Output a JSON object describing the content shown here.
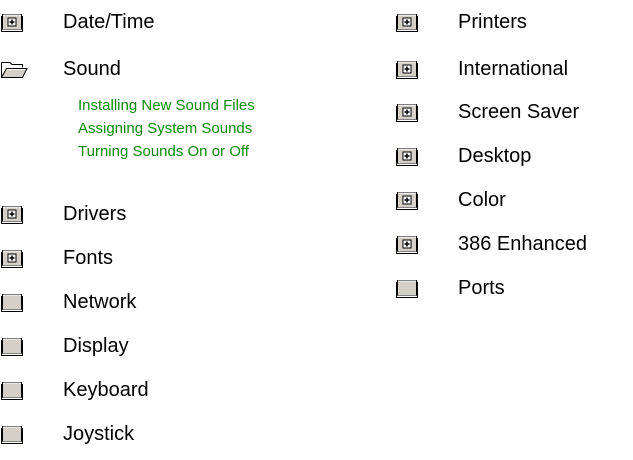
{
  "left_column": [
    {
      "label": "Date/Time",
      "icon": "book-closed-plus-icon"
    },
    {
      "label": "Sound",
      "icon": "book-open-icon"
    },
    {
      "label": "Drivers",
      "icon": "book-closed-plus-icon"
    },
    {
      "label": "Fonts",
      "icon": "book-closed-plus-icon"
    },
    {
      "label": "Network",
      "icon": "book-closed-icon"
    },
    {
      "label": "Display",
      "icon": "book-closed-icon"
    },
    {
      "label": "Keyboard",
      "icon": "book-closed-icon"
    },
    {
      "label": "Joystick",
      "icon": "book-closed-icon"
    }
  ],
  "sound_topics": [
    "Installing New Sound Files",
    "Assigning System Sounds",
    "Turning Sounds On or Off"
  ],
  "right_column": [
    {
      "label": "Printers",
      "icon": "book-closed-plus-icon"
    },
    {
      "label": "International",
      "icon": "book-closed-plus-icon"
    },
    {
      "label": "Screen Saver",
      "icon": "book-closed-plus-icon"
    },
    {
      "label": "Desktop",
      "icon": "book-closed-plus-icon"
    },
    {
      "label": "Color",
      "icon": "book-closed-plus-icon"
    },
    {
      "label": "386 Enhanced",
      "icon": "book-closed-plus-icon"
    },
    {
      "label": "Ports",
      "icon": "book-closed-icon"
    }
  ],
  "colors": {
    "topic_link": "#0a8a0a",
    "text": "#000000",
    "background": "#ffffff"
  }
}
